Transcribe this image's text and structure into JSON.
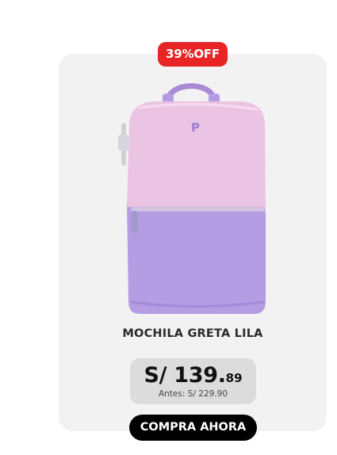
{
  "badge": {
    "label": "39%OFF",
    "color": "#e82424"
  },
  "product": {
    "title": "MOCHILA GRETA LILA",
    "image_icon": "backpack-image",
    "colors": {
      "top": "#ebc4e3",
      "bottom": "#b49de3",
      "handle": "#a98ad6"
    }
  },
  "price": {
    "currency_and_integer": "S/ 139.",
    "decimals": "89",
    "before": "Antes: S/ 229.90"
  },
  "cta": {
    "label": "COMPRA AHORA"
  }
}
